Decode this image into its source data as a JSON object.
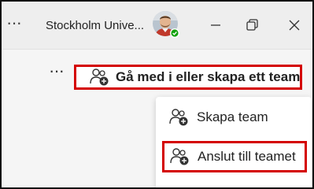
{
  "titlebar": {
    "org_name": "Stockholm Unive...",
    "more_icon": "more-dots-icon",
    "avatar_status": "available"
  },
  "window_controls": {
    "minimize_icon": "minimize-icon",
    "restore_icon": "restore-icon",
    "close_icon": "close-icon"
  },
  "toolbar": {
    "more_icon": "more-dots-icon",
    "join_or_create_label": "Gå med i eller skapa ett team"
  },
  "menu": {
    "items": [
      {
        "label": "Skapa team",
        "icon": "people-add-icon"
      },
      {
        "label": "Anslut till teamet",
        "icon": "people-add-icon"
      }
    ]
  },
  "colors": {
    "highlight": "#d40000",
    "status_available": "#13a10e"
  }
}
